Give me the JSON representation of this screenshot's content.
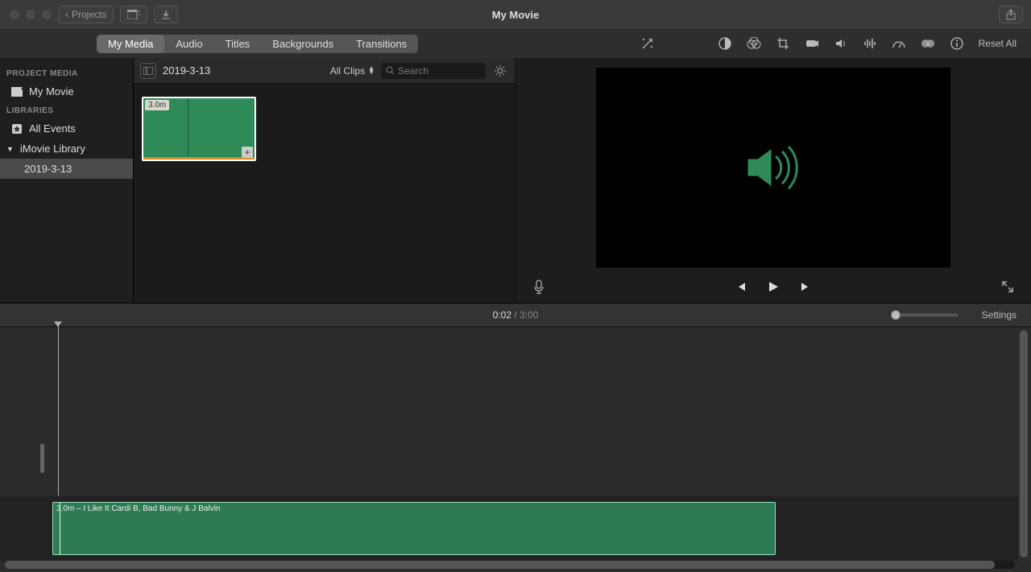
{
  "titlebar": {
    "back_label": "Projects",
    "title": "My Movie"
  },
  "tabs": {
    "items": [
      "My Media",
      "Audio",
      "Titles",
      "Backgrounds",
      "Transitions"
    ],
    "active": 0,
    "reset": "Reset All"
  },
  "sidebar": {
    "section1": "PROJECT MEDIA",
    "project": "My Movie",
    "section2": "LIBRARIES",
    "all_events": "All Events",
    "library": "iMovie Library",
    "event": "2019-3-13"
  },
  "browser": {
    "event_name": "2019-3-13",
    "filter": "All Clips",
    "search_placeholder": "Search",
    "clip_duration": "3.0m"
  },
  "playback": {
    "current": "0:02",
    "total": "3:00",
    "settings": "Settings"
  },
  "timeline": {
    "clip_label": "3.0m – I Like It Cardi B, Bad Bunny & J Balvin"
  }
}
